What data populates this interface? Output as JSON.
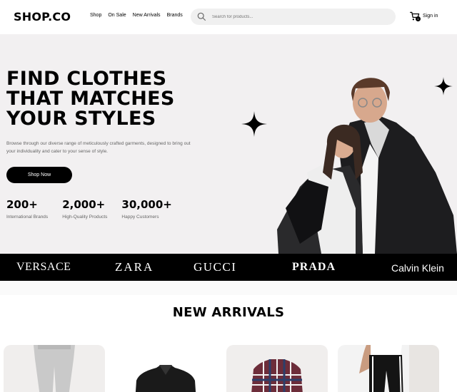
{
  "header": {
    "logo": "SHOP.CO",
    "nav": [
      "Shop",
      "On Sale",
      "New Arrivals",
      "Brands"
    ],
    "search_placeholder": "Search for products...",
    "cart_count": "1",
    "signin_label": "Sign in"
  },
  "hero": {
    "title_lines": [
      "FIND CLOTHES",
      "THAT MATCHES",
      "YOUR STYLES"
    ],
    "subtitle": "Browse through our diverse range of meticulously crafted garments, designed to bring out your individuality and cater to your sense of style.",
    "cta_label": "Shop Now",
    "stats": [
      {
        "value": "200+",
        "label": "International Brands"
      },
      {
        "value": "2,000+",
        "label": "High-Quality Products"
      },
      {
        "value": "30,000+",
        "label": "Happy Customers"
      }
    ]
  },
  "brands": [
    "VERSACE",
    "ZARA",
    "GUCCI",
    "PRADA",
    "Calvin Klein"
  ],
  "new_arrivals": {
    "title": "NEW ARRIVALS"
  },
  "colors": {
    "accent": "#000000",
    "hero_bg": "#f2f0f1",
    "card_bg": "#f0eeed",
    "search_bg": "#f0f0f0"
  }
}
